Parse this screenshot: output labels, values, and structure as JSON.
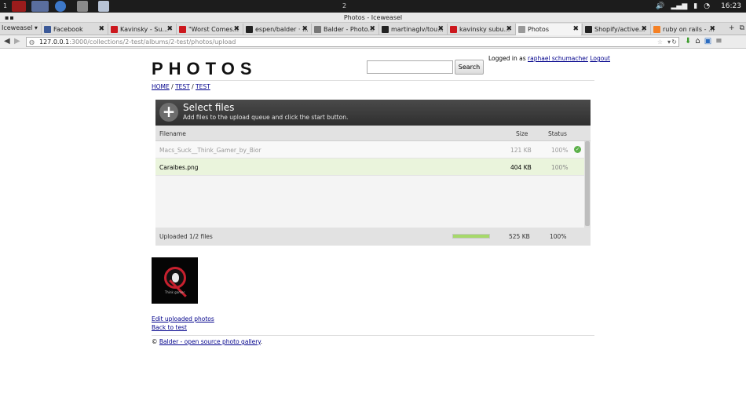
{
  "taskbar": {
    "workspace_left": "1",
    "workspace_center": "2",
    "clock": "16:23"
  },
  "window": {
    "title": "Photos - Iceweasel"
  },
  "browser": {
    "app_menu": "Iceweasel",
    "tabs": [
      {
        "title": "Facebook",
        "icon": "facebook-icon",
        "color": "#3b5998"
      },
      {
        "title": "Kavinsky - Su...",
        "icon": "youtube-icon",
        "color": "#cc181e"
      },
      {
        "title": "\"Worst Comes...",
        "icon": "youtube-icon",
        "color": "#cc181e"
      },
      {
        "title": "espen/balder · ...",
        "icon": "github-icon",
        "color": "#222222"
      },
      {
        "title": "Balder - Photo...",
        "icon": "page-icon",
        "color": "#777777"
      },
      {
        "title": "martinaglv/tou...",
        "icon": "github-icon",
        "color": "#222222"
      },
      {
        "title": "kavinsky subu...",
        "icon": "youtube-icon",
        "color": "#cc181e"
      },
      {
        "title": "Photos",
        "icon": "page-icon",
        "color": "#999999"
      },
      {
        "title": "Shopify/active...",
        "icon": "github-icon",
        "color": "#222222"
      },
      {
        "title": "ruby on rails - ...",
        "icon": "stackoverflow-icon",
        "color": "#f48024"
      }
    ],
    "url_host": "127.0.0.1",
    "url_path": ":3000/collections/2-test/albums/2-test/photos/upload"
  },
  "page": {
    "logo": "PHOTOS",
    "search_button": "Search",
    "search_value": "",
    "login_prefix": "Logged in as",
    "login_user": "raphael schumacher",
    "logout": "Logout",
    "breadcrumbs": [
      "HOME",
      "TEST",
      "TEST"
    ],
    "uploader": {
      "title": "Select files",
      "subtitle": "Add files to the upload queue and click the start button.",
      "columns": {
        "filename": "Filename",
        "size": "Size",
        "status": "Status"
      },
      "files": [
        {
          "name": "Macs_Suck__Think_Gamer_by_Bior",
          "size": "121 KB",
          "status": "100%",
          "done": true
        },
        {
          "name": "Caraibes.png",
          "size": "404 KB",
          "status": "100%",
          "done": false
        }
      ],
      "footer_status": "Uploaded 1/2 files",
      "total_size": "525 KB",
      "total_percent": "100%",
      "progress": 1.0
    },
    "thumbnail_caption": "Think gamer",
    "edit_link": "Edit uploaded photos",
    "back_link": "Back to test",
    "footer_copy": "©",
    "footer_link": "Balder - open source photo gallery",
    "footer_period": "."
  }
}
